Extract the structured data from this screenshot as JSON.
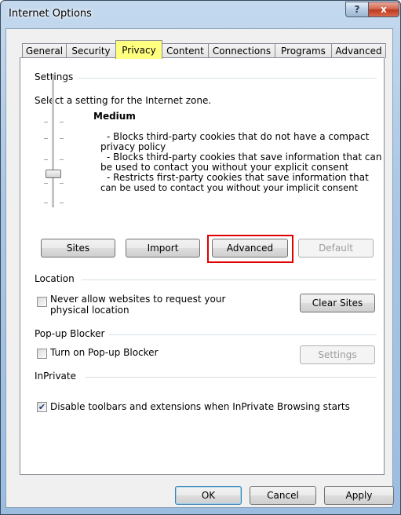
{
  "window": {
    "title": "Internet Options",
    "help_glyph": "?",
    "close_glyph": "x"
  },
  "tabs": [
    "General",
    "Security",
    "Privacy",
    "Content",
    "Connections",
    "Programs",
    "Advanced"
  ],
  "settings": {
    "group_label": "Settings",
    "zone_text": "Select a setting for the Internet zone.",
    "level": "Medium",
    "description": [
      "- Blocks third-party cookies that do not have a compact",
      "privacy policy",
      "- Blocks third-party cookies that save information that can",
      "be used to contact you without your explicit consent",
      "- Restricts first-party cookies that save information that",
      "can be used to contact you without your implicit consent"
    ],
    "buttons": {
      "sites": "Sites",
      "import": "Import",
      "advanced": "Advanced",
      "default": "Default"
    }
  },
  "location": {
    "group_label": "Location",
    "checkbox_label_line1": "Never allow websites to request your",
    "checkbox_label_line2": "physical location",
    "checked": false,
    "clear_sites": "Clear Sites"
  },
  "popup": {
    "group_label": "Pop-up Blocker",
    "checkbox_label": "Turn on Pop-up Blocker",
    "checked": false,
    "settings_button": "Settings"
  },
  "inprivate": {
    "group_label": "InPrivate",
    "checkbox_label": "Disable toolbars and extensions when InPrivate Browsing starts",
    "checked": true,
    "check_glyph": "✔"
  },
  "dialog_buttons": {
    "ok": "OK",
    "cancel": "Cancel",
    "apply": "Apply"
  }
}
